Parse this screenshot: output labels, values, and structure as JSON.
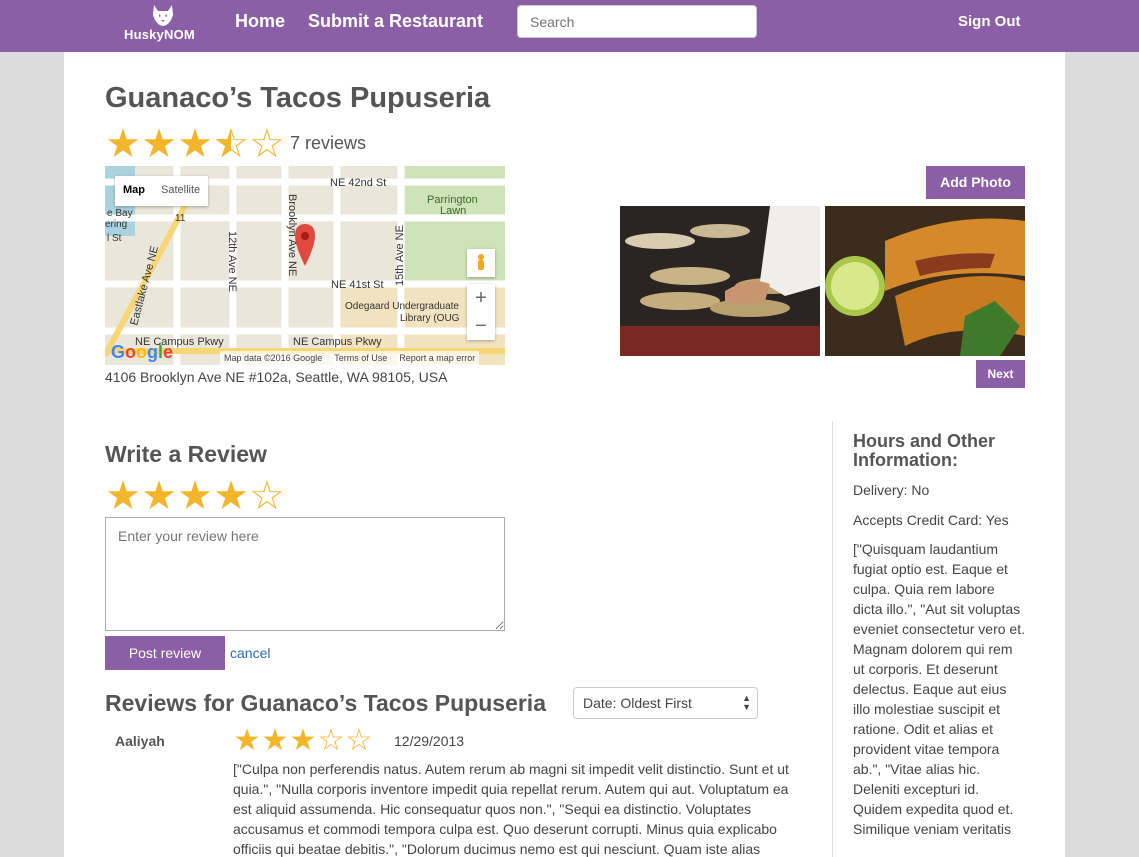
{
  "nav": {
    "logo_text": "HuskyNOM",
    "home": "Home",
    "submit": "Submit a Restaurant",
    "search_placeholder": "Search",
    "signout": "Sign Out"
  },
  "restaurant": {
    "name": "Guanaco’s Tacos Pupuseria",
    "rating": 3.5,
    "reviews_count": "7 reviews",
    "address": "4106 Brooklyn Ave NE #102a, Seattle, WA 98105, USA"
  },
  "map": {
    "btn_map": "Map",
    "btn_satellite": "Satellite",
    "zoom_in": "+",
    "zoom_out": "−",
    "google": "Google",
    "footer": [
      "Map data ©2016 Google",
      "Terms of Use",
      "Report a map error"
    ],
    "labels": [
      "NE 42nd St",
      "Parrington Lawn",
      "Brooklyn Ave NE",
      "12th Ave NE",
      "15th Ave NE",
      "NE 41st St",
      "Odegaard Undergraduate Library (OUG",
      "Eastlake Ave NE",
      "NE Campus Pkwy",
      "NE Campus Pkwy",
      "e Bay",
      "ering",
      "l St",
      "11"
    ]
  },
  "photos": {
    "add_photo": "Add Photo",
    "next": "Next"
  },
  "write_review": {
    "heading": "Write a Review",
    "rating": 4,
    "placeholder": "Enter your review here",
    "post": "Post review",
    "cancel": "cancel"
  },
  "reviews": {
    "heading": "Reviews for Guanaco’s Tacos Pupuseria",
    "sort": "Date: Oldest First",
    "items": [
      {
        "author": "Aaliyah",
        "rating": 3,
        "date": "12/29/2013",
        "text": "[\"Culpa non perferendis natus. Autem rerum ab magni sit impedit velit distinctio. Sunt et ut quia.\", \"Nulla corporis inventore impedit quia repellat rerum. Autem qui aut. Voluptatum ea est aliquid assumenda. Hic consequatur quos non.\", \"Sequi ea distinctio. Voluptates accusamus et commodi tempora culpa est. Quo deserunt corrupti. Minus quia explicabo officiis qui beatae debitis.\", \"Dolorum ducimus nemo est qui nesciunt. Quam iste alias"
      }
    ]
  },
  "sidebar": {
    "heading": "Hours and Other Information:",
    "delivery": "Delivery: No",
    "credit": "Accepts Credit Card: Yes",
    "info": "[\"Quisquam laudantium fugiat optio est. Eaque et culpa. Quia rem labore dicta illo.\", \"Aut sit voluptas eveniet consectetur vero et. Magnam dolorem qui rem ut corporis. Et deserunt delectus. Eaque aut eius illo molestiae suscipit et ratione. Odit et alias et provident vitae tempora ab.\", \"Vitae alias hic. Deleniti excepturi id. Quidem expedita quod et. Similique veniam veritatis"
  },
  "colors": {
    "brand": "#8a5fa6",
    "star": "#f5b52b",
    "link": "#2a6bb3"
  }
}
